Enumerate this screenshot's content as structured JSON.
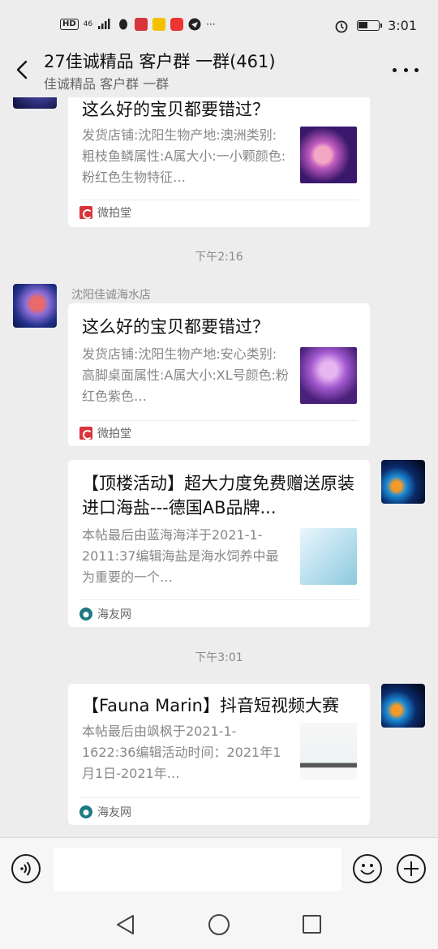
{
  "status": {
    "left_badge": "HD",
    "signal": "46",
    "time": "3:01",
    "more": "···"
  },
  "header": {
    "title": "27佳诚精品 客户群 一群(461)",
    "subtitle": "佳诚精品 客户群 一群"
  },
  "messages": [
    {
      "type": "card",
      "direction": "incoming",
      "title": "这么好的宝贝都要错过？",
      "desc": "发货店铺:沈阳生物产地:澳洲类别:粗枝鱼鳞属性:A属大小:一小颗颜色:粉红色生物特征…",
      "source": "微拍堂"
    },
    {
      "type": "time",
      "text": "下午2:16"
    },
    {
      "type": "card",
      "direction": "incoming",
      "sender": "沈阳佳诚海水店",
      "title": "这么好的宝贝都要错过？",
      "desc": "发货店铺:沈阳生物产地:安心类别:高脚桌面属性:A属大小:XL号颜色:粉红色紫色…",
      "source": "微拍堂"
    },
    {
      "type": "card",
      "direction": "outgoing",
      "title": "【顶楼活动】超大力度免费赠送原装进口海盐---德国AB品牌...",
      "desc": "本帖最后由蓝海海洋于2021-1-2011:37编辑海盐是海水饲养中最为重要的一个…",
      "source": "海友网"
    },
    {
      "type": "time",
      "text": "下午3:01"
    },
    {
      "type": "card",
      "direction": "outgoing",
      "title": "【Fauna Marin】抖音短视频大赛",
      "desc": "本帖最后由飒枫于2021-1-1622:36编辑活动时间：2021年1月1日-2021年…",
      "source": "海友网"
    }
  ],
  "colors": {
    "chat_bg": "#ededed",
    "card_bg": "#ffffff",
    "weipaitang_red": "#d8343a",
    "haiyou_teal": "#1d7a83"
  },
  "icons": {
    "back": "chevron-left-icon",
    "more": "more-dots-icon",
    "voice": "voice-icon",
    "emoji": "emoji-icon",
    "plus": "plus-icon"
  }
}
